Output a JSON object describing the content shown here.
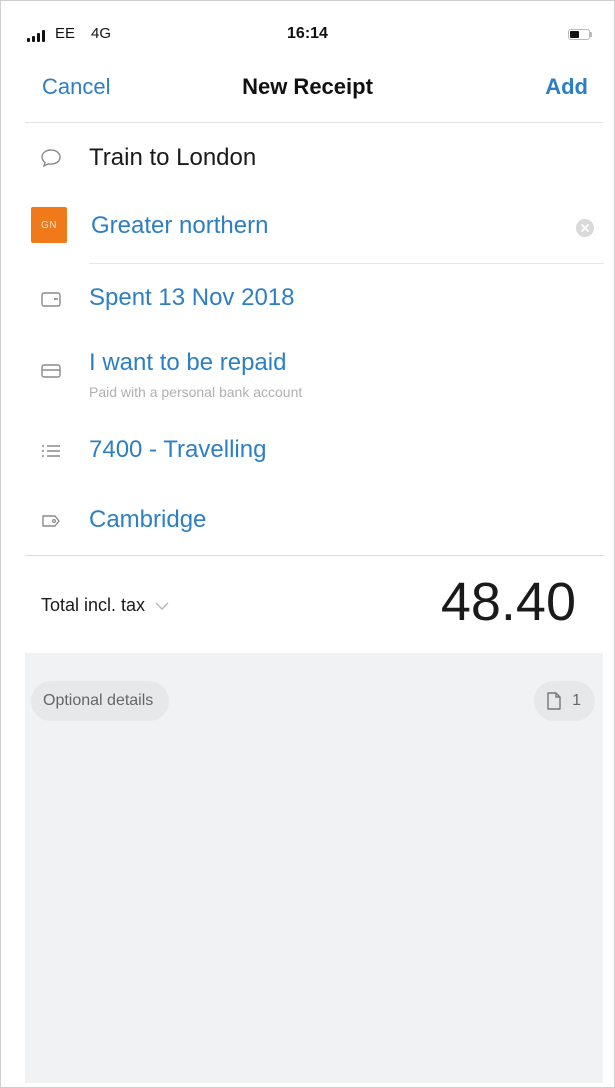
{
  "status_bar": {
    "carrier": "EE",
    "network": "4G",
    "time": "16:14"
  },
  "nav": {
    "cancel_label": "Cancel",
    "title": "New Receipt",
    "add_label": "Add"
  },
  "fields": {
    "description": "Train to London",
    "supplier": {
      "badge": "GN",
      "name": "Greater northern"
    },
    "date": "Spent 13 Nov 2018",
    "payment": {
      "title": "I want to be repaid",
      "subtitle": "Paid with a personal bank account"
    },
    "category": "7400 - Travelling",
    "location": "Cambridge"
  },
  "total": {
    "label": "Total incl. tax",
    "value": "48.40"
  },
  "optional": {
    "label": "Optional details",
    "attachment_count": "1"
  },
  "colors": {
    "accent": "#2d7fc4",
    "badge": "#f07a1a"
  }
}
